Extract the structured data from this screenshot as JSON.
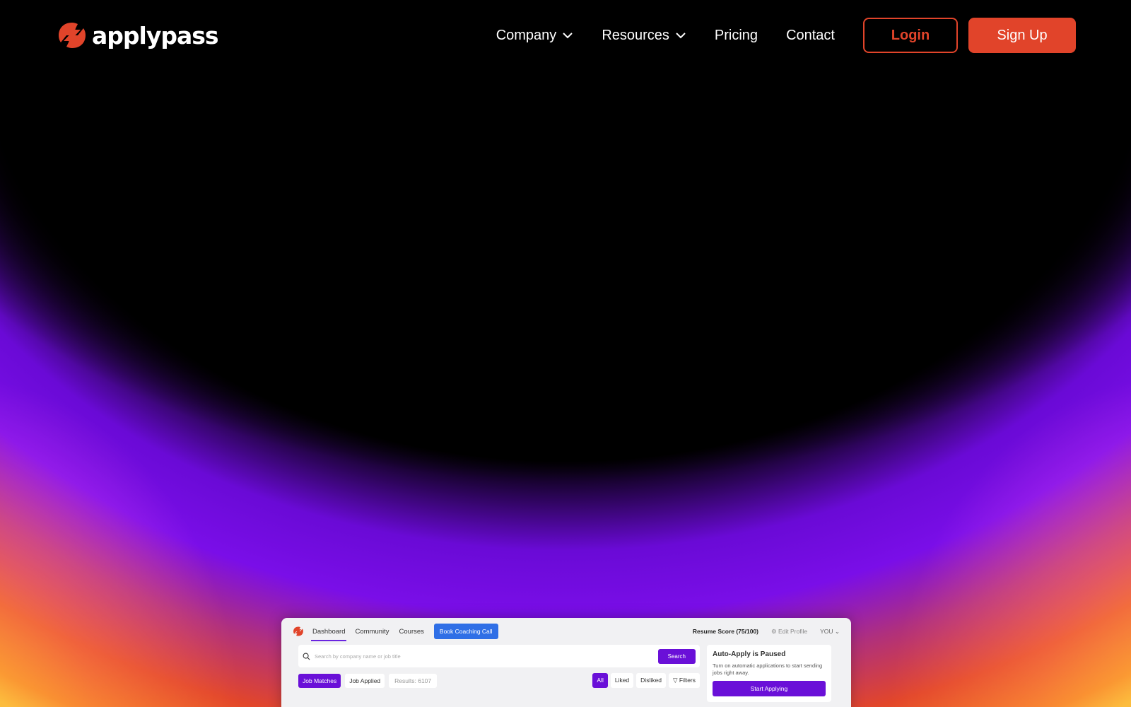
{
  "brand": {
    "name": "applypass",
    "accent": "#e1442a"
  },
  "nav": {
    "items": [
      {
        "label": "Company",
        "dropdown": true
      },
      {
        "label": "Resources",
        "dropdown": true
      },
      {
        "label": "Pricing",
        "dropdown": false
      },
      {
        "label": "Contact",
        "dropdown": false
      }
    ],
    "login_label": "Login",
    "signup_label": "Sign Up"
  },
  "preview": {
    "tabs": [
      "Dashboard",
      "Community",
      "Courses"
    ],
    "active_tab": "Dashboard",
    "coach_label": "Book Coaching Call",
    "resume_score": "Resume Score (75/100)",
    "edit_profile": "Edit Profile",
    "user": "YOU",
    "search_placeholder": "Search by company name or job title",
    "search_button": "Search",
    "job_matches": "Job Matches",
    "job_applied": "Job Applied",
    "results": "Results: 6107",
    "filter_all": "All",
    "filter_liked": "Liked",
    "filter_disliked": "Disliked",
    "filter_filters": "Filters",
    "side_title": "Auto-Apply is Paused",
    "side_desc": "Turn on automatic applications to start sending jobs right away.",
    "start_button": "Start Applying",
    "accent_purple": "#6a10d8",
    "coach_blue": "#2f6fe6"
  }
}
